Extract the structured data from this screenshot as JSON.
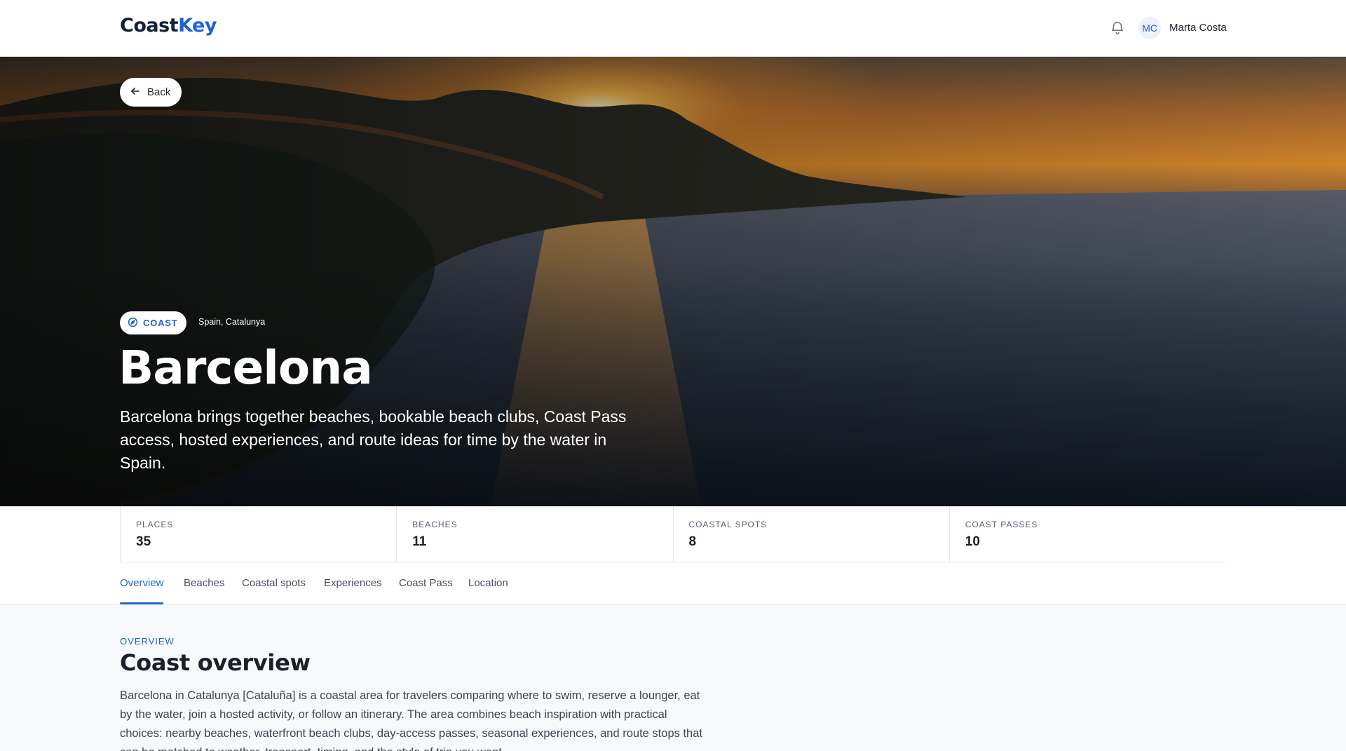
{
  "header": {
    "logo_part1": "Coast",
    "logo_part2": "Key",
    "notification_icon": "bell-icon",
    "avatar_initials": "MC",
    "user_name": "Marta Costa"
  },
  "hero": {
    "back_label": "Back",
    "back_icon": "arrow-left-icon",
    "badge_icon": "compass-icon",
    "badge_label": "COAST",
    "region": "Spain, Catalunya",
    "city": "Barcelona",
    "description": "Barcelona brings together beaches, bookable beach clubs, Coast Pass access, hosted experiences, and route ideas for time by the water in Spain."
  },
  "stats": [
    {
      "label": "PLACES",
      "value": "35"
    },
    {
      "label": "BEACHES",
      "value": "11"
    },
    {
      "label": "COASTAL SPOTS",
      "value": "8"
    },
    {
      "label": "COAST PASSES",
      "value": "10"
    }
  ],
  "tabs": [
    {
      "label": "Overview",
      "active": true
    },
    {
      "label": "Beaches",
      "active": false
    },
    {
      "label": "Coastal spots",
      "active": false
    },
    {
      "label": "Experiences",
      "active": false
    },
    {
      "label": "Coast Pass",
      "active": false
    },
    {
      "label": "Location",
      "active": false
    }
  ],
  "overview": {
    "eyebrow": "OVERVIEW",
    "title": "Coast overview",
    "body": "Barcelona in Catalunya [Cataluña] is a coastal area for travelers comparing where to swim, reserve a lounger, eat by the water, join a hosted activity, or follow an itinerary. The area combines beach inspiration with practical choices: nearby beaches, waterfront beach clubs, day-access passes, seasonal experiences, and route stops that can be matched to weather, transport, timing, and the style of trip you want."
  },
  "colors": {
    "accent": "#1e63d6",
    "logo_dark": "#12223b",
    "section_bg": "#f7f9fc"
  }
}
